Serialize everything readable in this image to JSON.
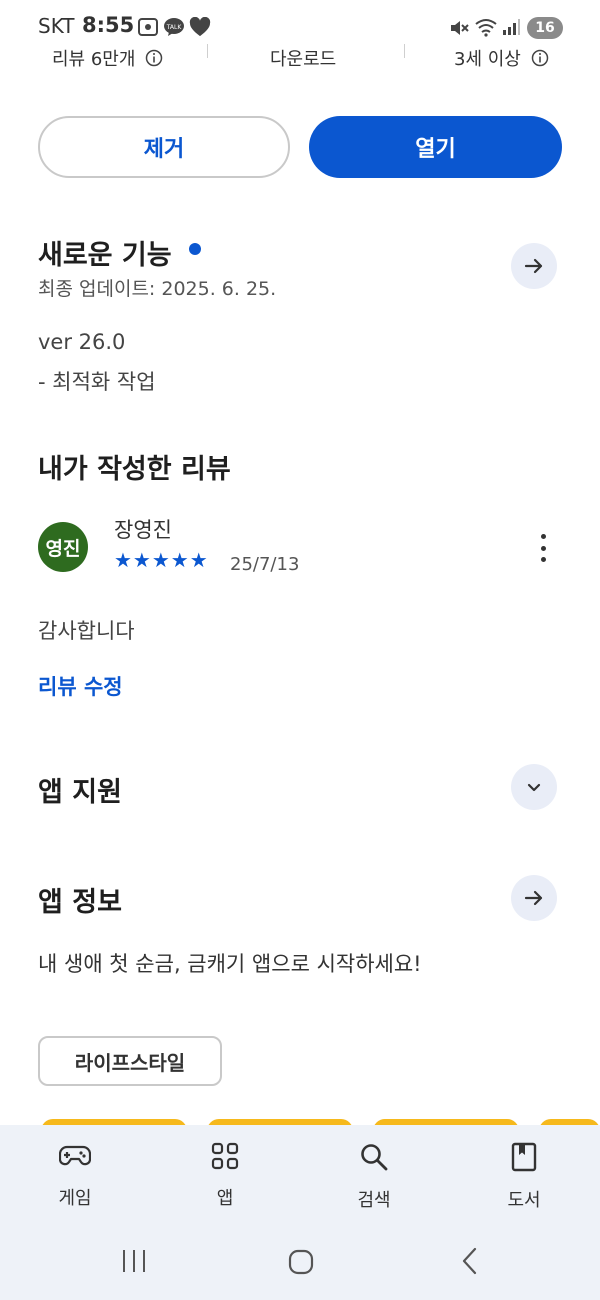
{
  "status_bar": {
    "carrier": "SKT",
    "time": "8:55",
    "battery": "16"
  },
  "stats": {
    "reviews": "리뷰 6만개",
    "downloads": "다운로드",
    "age": "3세 이상"
  },
  "actions": {
    "uninstall": "제거",
    "open": "열기"
  },
  "whats_new": {
    "title": "새로운 기능",
    "updated": "최종 업데이트: 2025. 6. 25.",
    "version": "ver 26.0",
    "note": "- 최적화 작업",
    "accent_color": "#0b57d0"
  },
  "my_review": {
    "heading": "내가 작성한 리뷰",
    "author": "장영진",
    "avatar_text": "영진",
    "rating": 5,
    "stars": "★★★★★",
    "date": "25/7/13",
    "body": "감사합니다",
    "edit_link": "리뷰 수정"
  },
  "app_support": {
    "title": "앱 지원"
  },
  "app_info": {
    "title": "앱 정보",
    "description": "내 생애 첫 순금, 금캐기 앱으로 시작하세요!",
    "category_chip": "라이프스타일"
  },
  "bottom_nav": {
    "items": [
      {
        "label": "게임",
        "icon": "gamepad-icon"
      },
      {
        "label": "앱",
        "icon": "apps-grid-icon"
      },
      {
        "label": "검색",
        "icon": "search-icon"
      },
      {
        "label": "도서",
        "icon": "book-icon"
      }
    ]
  },
  "colors": {
    "primary": "#0b57d0",
    "avatar_bg": "#2e6b1f",
    "nav_bg": "#eef2f8",
    "card_accent": "#f6b91c"
  }
}
